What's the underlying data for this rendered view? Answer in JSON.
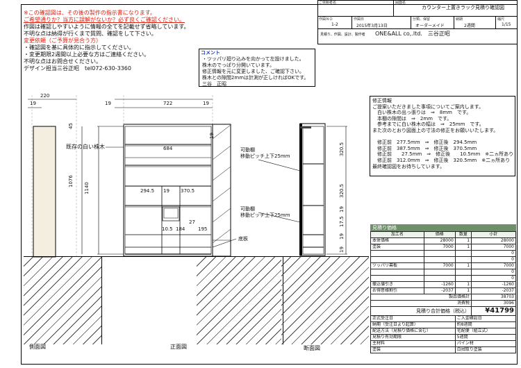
{
  "notes_box": {
    "lines": [
      {
        "text": "※この確認図は、その後の製作の指示書になります。",
        "style": "red"
      },
      {
        "text": "ご希望通りか？当方に誤解がないか？必ず良くご確認ください。",
        "style": "red-underline"
      },
      {
        "text": "作図は確認しやすいように情報の全てを記載せず省略しています。",
        "style": "normal"
      },
      {
        "text": "不明な点は納得が行くまで質問、確認をして下さい。",
        "style": "normal"
      },
      {
        "text": "変更依頼（ご予算が見合う方）",
        "style": "red"
      },
      {
        "text": "・確認図を基に具体的に指示してください。",
        "style": "normal"
      },
      {
        "text": "・変更期限2週間以上必要な方はご連絡ください。",
        "style": "normal"
      },
      {
        "text": "不明な点はお問合せください。",
        "style": "normal"
      },
      {
        "text": "デザイン担当三谷正昭　tel072-630-3360",
        "style": "normal"
      }
    ]
  },
  "title_block": {
    "customer_label": "ご依頼者名",
    "drawing_name_label": "図面名",
    "drawing_name": "カウンター上置きラック見積り確認図",
    "drawing_no_label": "作図ＮＯ",
    "drawing_no": "1-2",
    "date_label": "作図日",
    "date": "2015年3月13日",
    "category_label": "分類、保留",
    "category": "オーダーメイド",
    "period_label": "納期",
    "period": "2週間",
    "scale_label": "縮尺",
    "scale": "1/15",
    "producer_label": "見積り、作図、設計、製作者",
    "producer": "ONE&ALL co,.ltd.　三谷正昭"
  },
  "comment_box": {
    "title": "コメント",
    "lines": [
      "・ツッパリ廻り込みを向かって左設けました。",
      "株木のでっぱり分開いています。",
      "修正情報を元に変更しました、ご確認下さい。",
      "株木との隙間2mmは計測が正しければOKです。",
      "三谷　正昭"
    ]
  },
  "revision_box": {
    "lines": [
      "修正情報",
      "ご提案いただきました事項についてご案内します。",
      "　白い株木の出っ張りは　⇒　8mm　です。",
      "　本棚の隙間は　⇒　2mm　です。",
      "　参考までに白い株木の幅は　⇒　25mm　です。",
      "また次のとおり図面上の寸法の修正をお願いいたします。",
      "",
      "　修正前　277.5mm　⇒　修正後　294.5mm",
      "　修正前　387.5mm　⇒　修正後　370.5mm",
      "　修正前　　27.5mm　⇒　修正後　　10.5mm　※二ヵ所あり",
      "　修正前　312.0mm　⇒　修正後　320.5mm　※二ヵ所あり",
      "最終確認図をお待ちしています。"
    ]
  },
  "estimate": {
    "title": "見積り価格",
    "headers": [
      "加工名",
      "価格",
      "数量",
      "小計"
    ],
    "rows": [
      [
        "本体価格",
        "28000",
        "1",
        "28000"
      ],
      [
        "塗装",
        "7000",
        "1",
        "7000"
      ],
      [
        "",
        "",
        "",
        "0"
      ],
      [
        "",
        "",
        "",
        "0"
      ],
      [
        "ツッパリ幕板",
        "7000",
        "1",
        "7000"
      ],
      [
        "",
        "",
        "",
        "0"
      ],
      [
        "",
        "",
        "",
        "0"
      ],
      [
        "撤込値引き",
        "-1260",
        "1",
        "-1260"
      ],
      [
        "お得意様割引",
        "-2037",
        "1",
        "-2037"
      ]
    ],
    "product_price_label": "製品価格計",
    "product_price": "38703",
    "tax_label": "消費税",
    "tax": "3096",
    "total_label": "見積り合計価格（税込）",
    "total": "¥41799",
    "info": [
      [
        "正式受注日",
        "ご入金確認日"
      ],
      [
        "納期（受注日より起算）",
        "約8週間"
      ],
      [
        "配送方法（見積り価格に含む）",
        "宅配便（組立式）"
      ],
      [
        "見積り有効期限",
        "5週間"
      ],
      [
        "主材料",
        "パイン材"
      ],
      [
        "塗装",
        "白拭取り塗装"
      ]
    ]
  },
  "drawing": {
    "dims": {
      "d220": "220",
      "d19a": "19",
      "d19b": "19",
      "d722": "722",
      "d19c": "19",
      "d684": "684",
      "d2945": "294.5",
      "d19d": "19",
      "d3705": "370.5",
      "d105": "10.5",
      "d184": "184",
      "d27": "27",
      "d195": "195",
      "h45": "45",
      "h1076": "1076",
      "h1140": "1140",
      "h19r": "19",
      "h3205a": "320.5",
      "h3205b": "320.5",
      "h19e": "19",
      "h175": "17.5",
      "h19f": "19",
      "h19g": "19"
    },
    "labels": {
      "white_wood": "既存の白い株木",
      "shelf1": "可動棚",
      "pitch1": "移動ピッチ上下25mm",
      "shelf2": "可動棚",
      "pitch2": "移動ピッチ上下25mm",
      "base": "底板"
    },
    "views": {
      "side": "側面図",
      "front": "正面図",
      "section": "断面図"
    }
  }
}
